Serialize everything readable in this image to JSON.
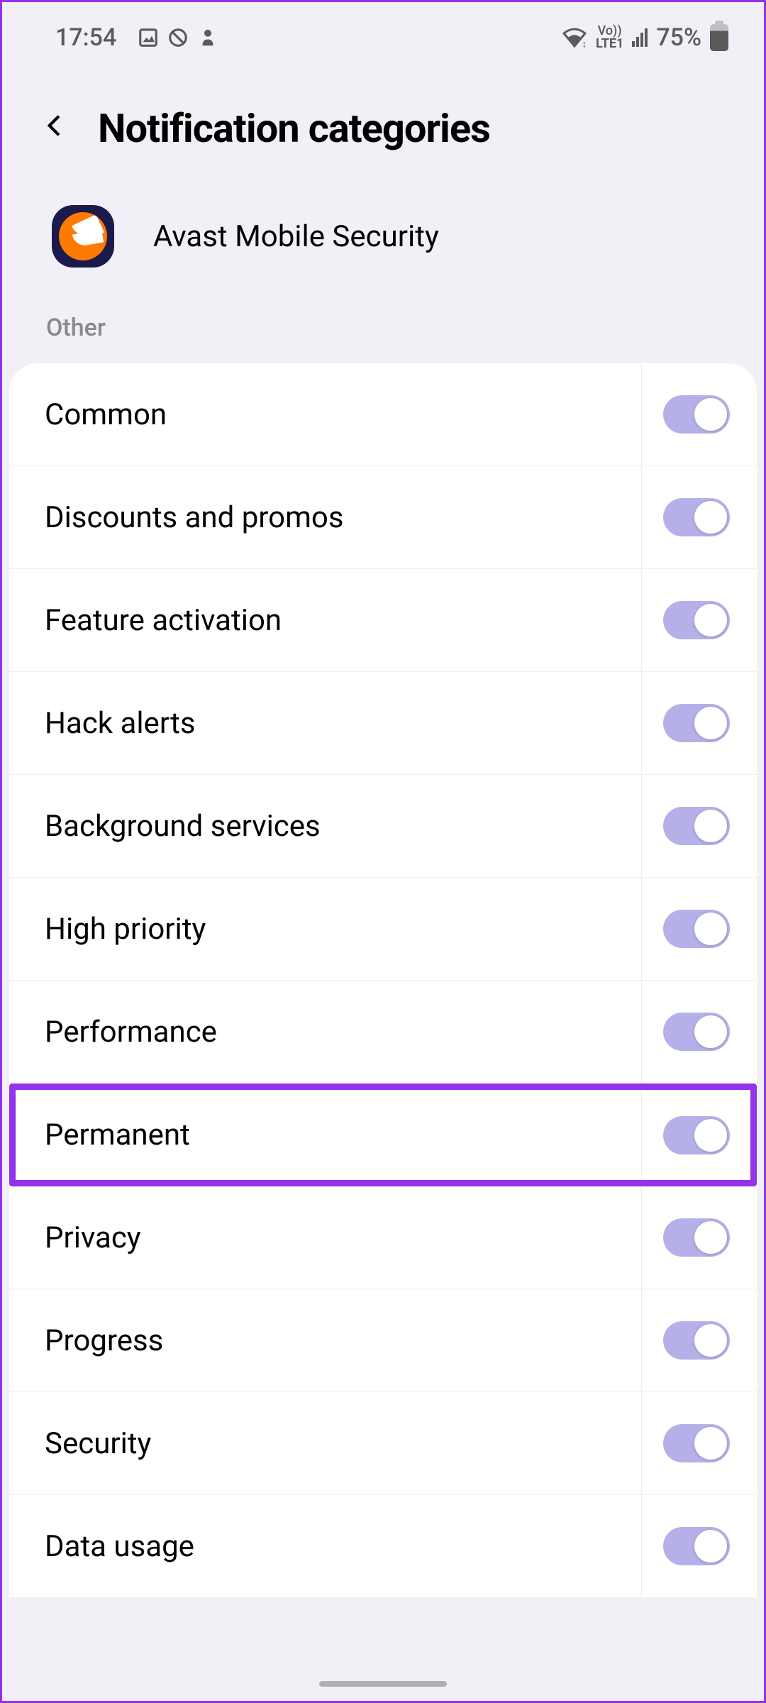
{
  "status_bar": {
    "time": "17:54",
    "lte_text_top": "Vo))",
    "lte_text_bottom": "LTE1",
    "battery_text": "75%"
  },
  "header": {
    "title": "Notification categories"
  },
  "app": {
    "name": "Avast Mobile Security"
  },
  "section": {
    "label": "Other"
  },
  "items": [
    {
      "label": "Common",
      "enabled": true,
      "highlighted": false
    },
    {
      "label": "Discounts and promos",
      "enabled": true,
      "highlighted": false
    },
    {
      "label": "Feature activation",
      "enabled": true,
      "highlighted": false
    },
    {
      "label": "Hack alerts",
      "enabled": true,
      "highlighted": false
    },
    {
      "label": "Background services",
      "enabled": true,
      "highlighted": false
    },
    {
      "label": "High priority",
      "enabled": true,
      "highlighted": false
    },
    {
      "label": "Performance",
      "enabled": true,
      "highlighted": false
    },
    {
      "label": "Permanent",
      "enabled": true,
      "highlighted": true
    },
    {
      "label": "Privacy",
      "enabled": true,
      "highlighted": false
    },
    {
      "label": "Progress",
      "enabled": true,
      "highlighted": false
    },
    {
      "label": "Security",
      "enabled": true,
      "highlighted": false
    },
    {
      "label": "Data usage",
      "enabled": true,
      "highlighted": false
    }
  ],
  "colors": {
    "highlight": "#9333ea",
    "toggle_on": "#b5b1e8",
    "app_icon_bg": "#1a1a4d",
    "app_icon_inner": "#ff7a00"
  }
}
